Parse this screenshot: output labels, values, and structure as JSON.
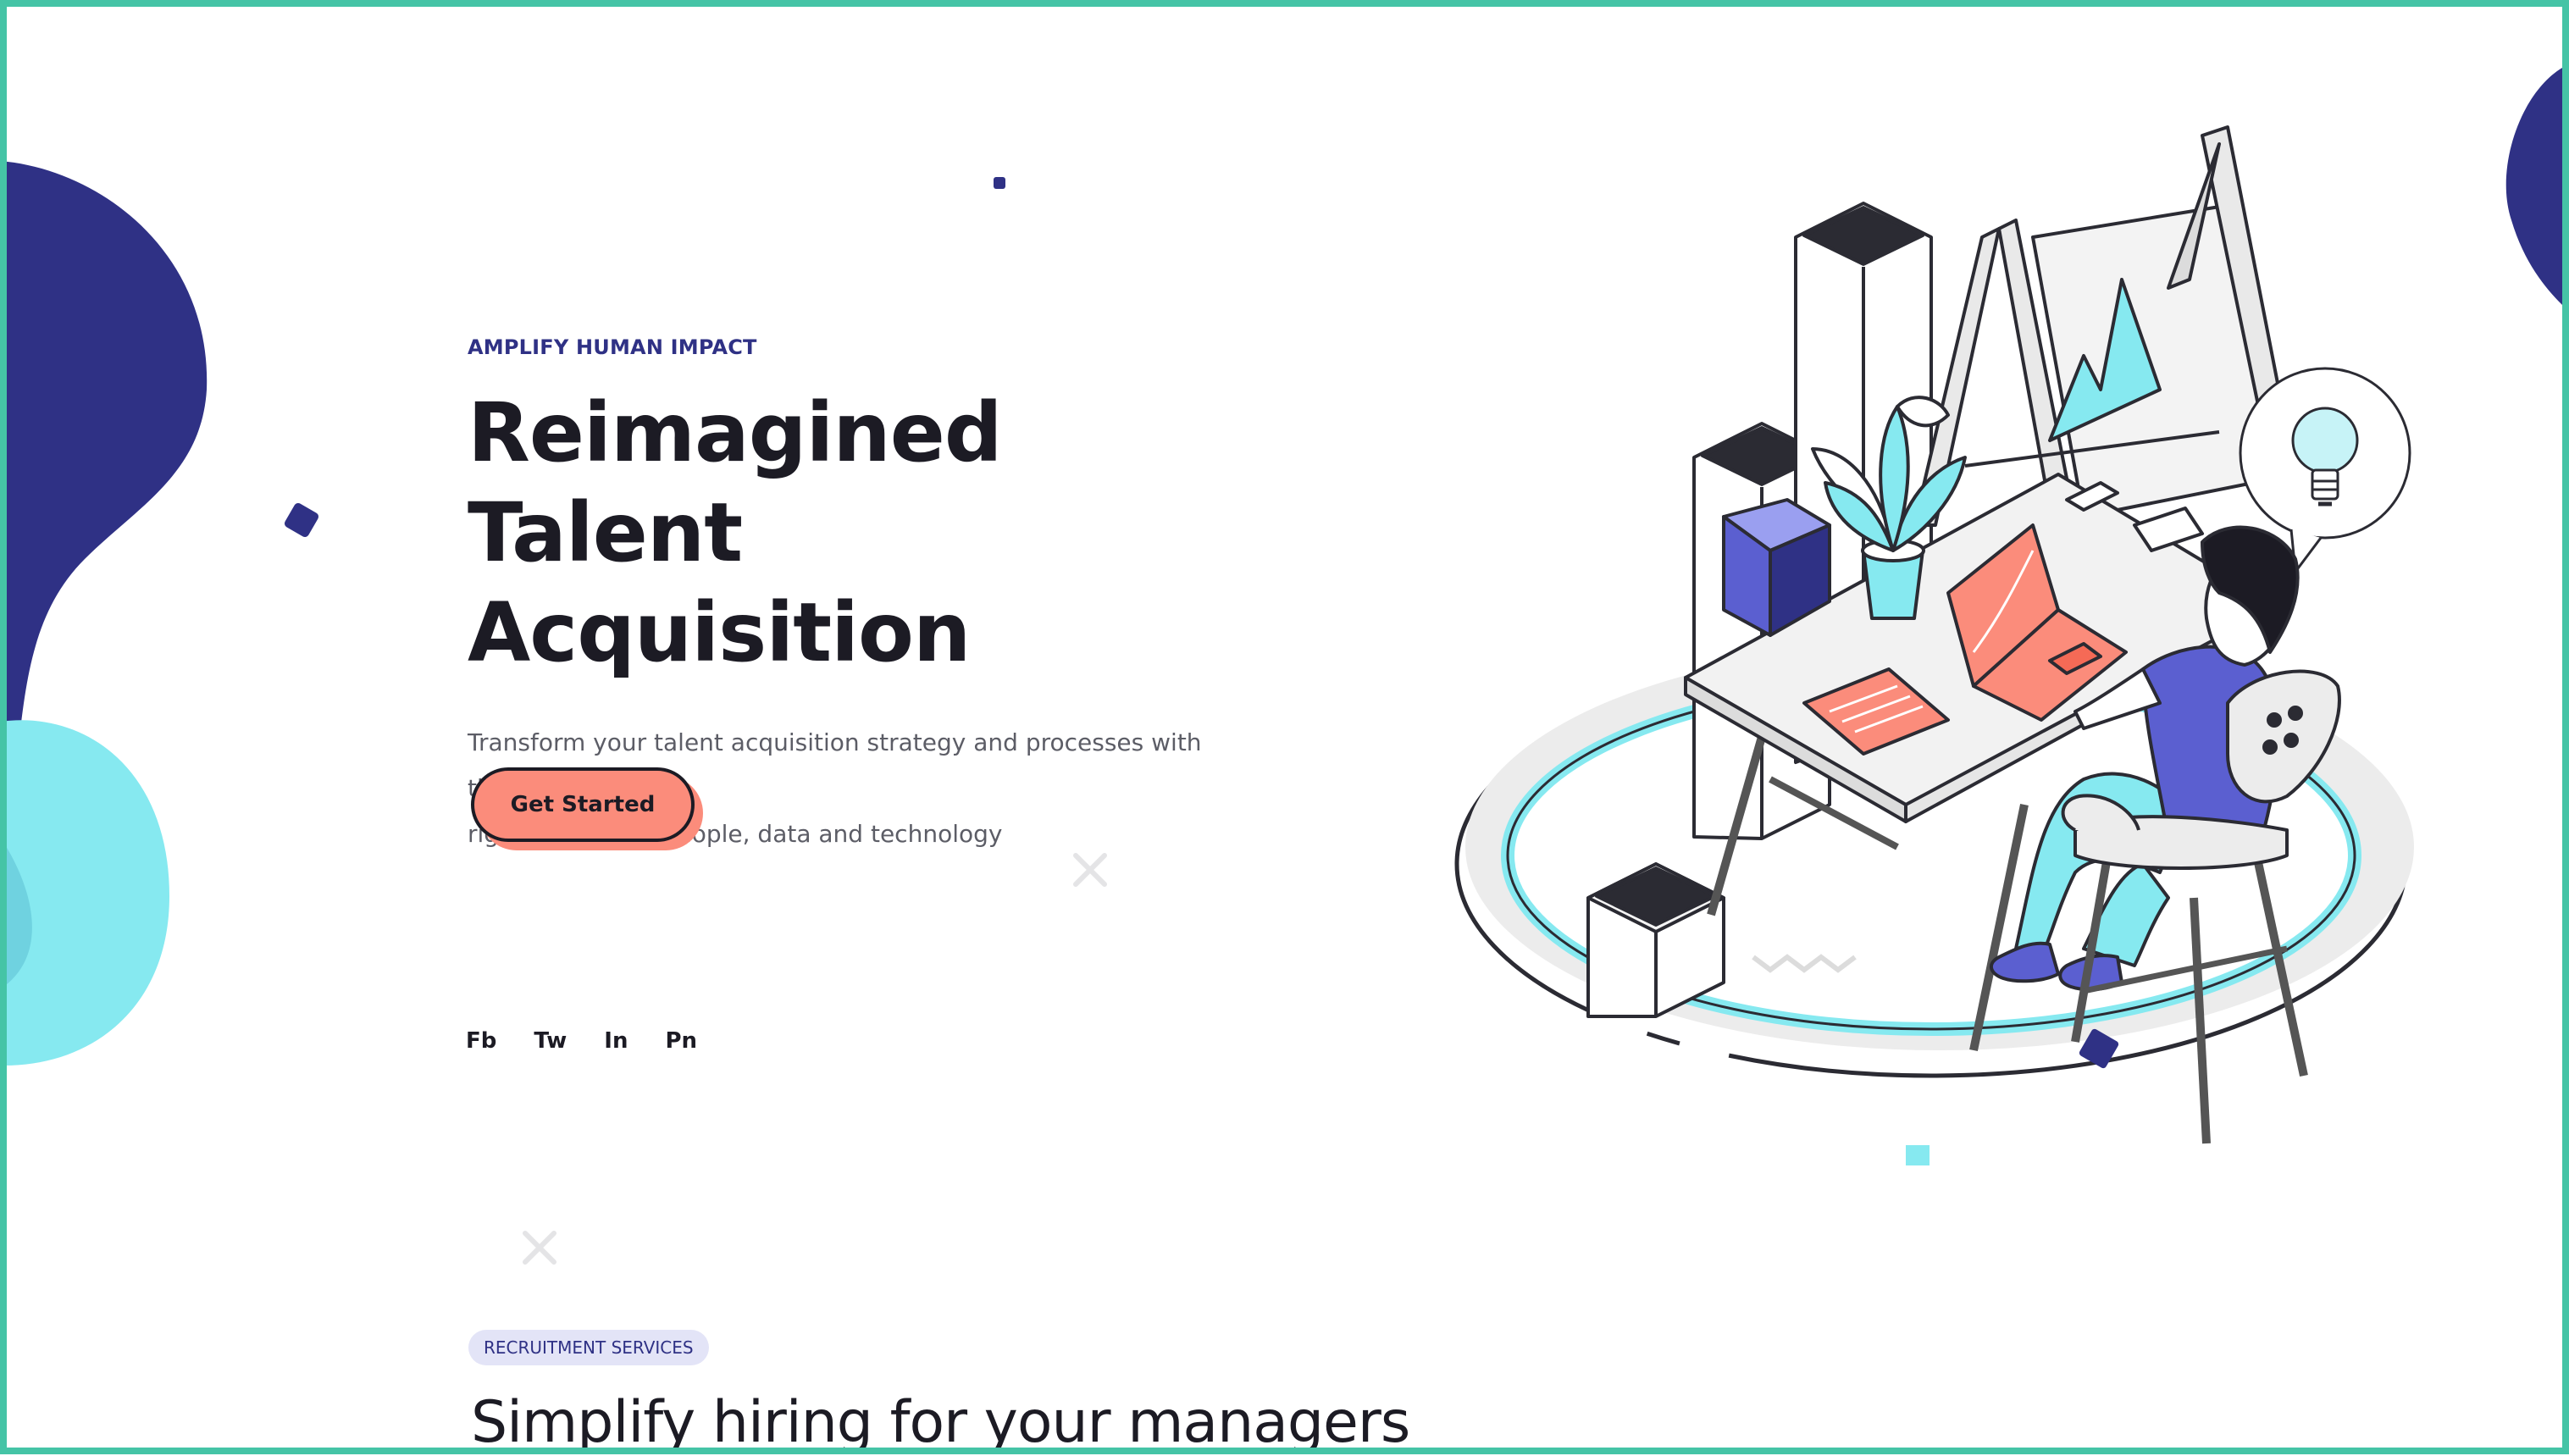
{
  "hero": {
    "eyebrow": "AMPLIFY HUMAN IMPACT",
    "title_line1": "Reimagined Talent",
    "title_line2": "Acquisition",
    "subtitle_line1": "Transform your talent acquisition strategy and processes with the",
    "subtitle_line2": "right balance of people, data and technology",
    "cta_label": "Get Started"
  },
  "social": [
    {
      "label": "Fb"
    },
    {
      "label": "Tw"
    },
    {
      "label": "In"
    },
    {
      "label": "Pn"
    }
  ],
  "services": {
    "tag": "RECRUITMENT SERVICES",
    "heading": "Simplify hiring for your managers"
  },
  "icons": [
    "diamond-decor-icon",
    "cross-decor-icon",
    "lightbulb-icon",
    "plant-icon",
    "laptop-icon",
    "chair-icon"
  ],
  "colors": {
    "frame": "#45c4a6",
    "navy": "#2f3185",
    "cyan": "#86e9f0",
    "coral": "#fb8c7b",
    "ink": "#1c1b24",
    "tag_bg": "#e3e4f7"
  }
}
